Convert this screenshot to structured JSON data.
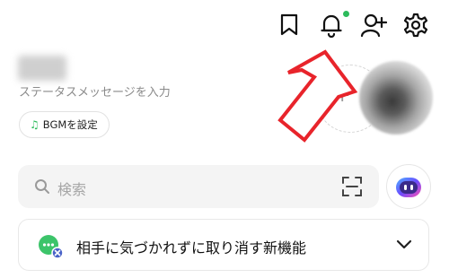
{
  "header": {
    "icons": [
      "bookmark-icon",
      "bell-icon",
      "add-friend-icon",
      "settings-icon"
    ],
    "notification_dot_color": "#2dbb5c"
  },
  "profile": {
    "status_message_placeholder": "ステータスメッセージを入力",
    "bgm_button_label": "BGMを設定",
    "add_photo_symbol": "+"
  },
  "search": {
    "placeholder": "検索"
  },
  "banner": {
    "text": "相手に気づかれずに取り消す新機能"
  },
  "colors": {
    "accent_green": "#2dbb5c",
    "arrow_red": "#e8242b",
    "ai_purple": "#6a4cff"
  }
}
